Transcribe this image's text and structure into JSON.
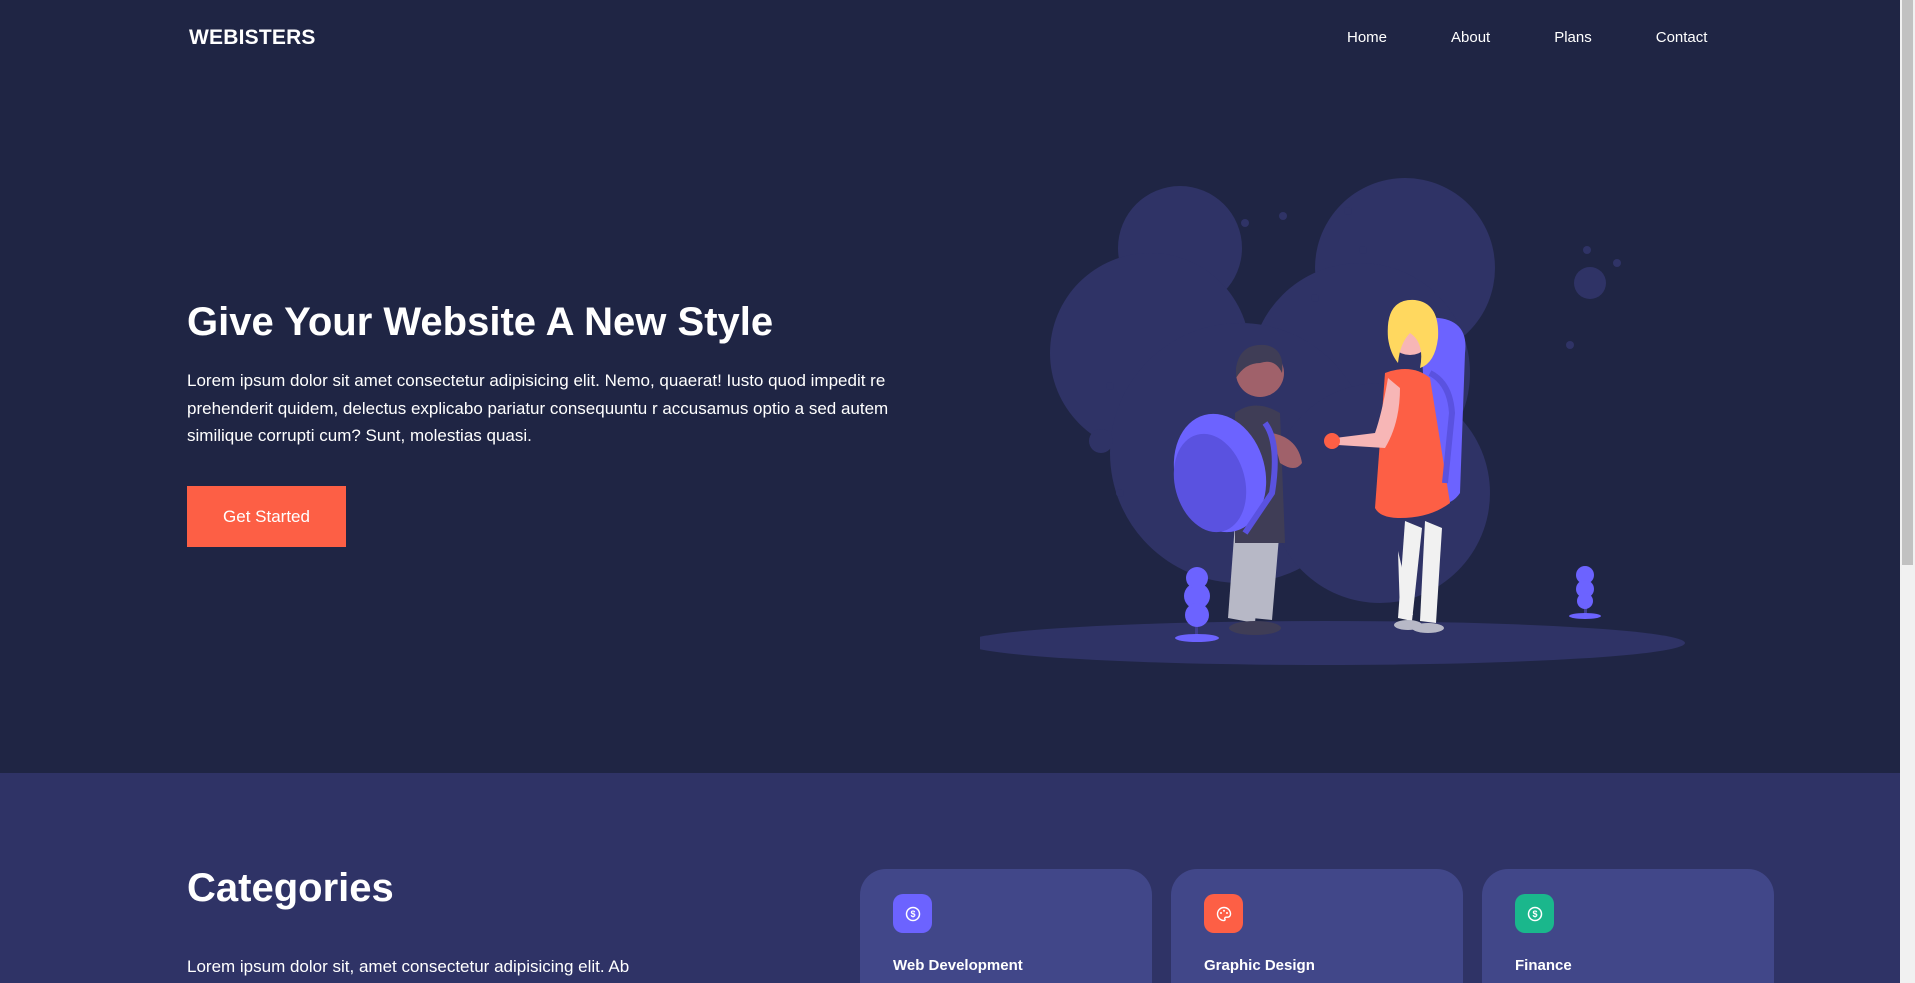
{
  "nav": {
    "brand": "WEBISTERS",
    "links": [
      "Home",
      "About",
      "Plans",
      "Contact"
    ]
  },
  "hero": {
    "title": "Give Your Website A New Style",
    "text": "Lorem ipsum dolor sit amet consectetur adipisicing elit. Nemo, quaerat! Iusto quod impedit re prehenderit quidem, delectus explicabo pariatur consequuntu r accusamus optio a sed autem similique corrupti cum? Sunt, molestias quasi.",
    "cta_label": "Get Started"
  },
  "categories": {
    "title": "Categories",
    "text": "Lorem ipsum dolor sit, amet consectetur adipisicing elit. Ab",
    "cards": [
      {
        "title": "Web Development",
        "icon": "dollar-icon",
        "color": "#6c63ff"
      },
      {
        "title": "Graphic Design",
        "icon": "palette-icon",
        "color": "#fd5f45"
      },
      {
        "title": "Finance",
        "icon": "dollar-icon",
        "color": "#1ab78c"
      }
    ]
  },
  "colors": {
    "hero_bg": "#1f2544",
    "section_bg": "#2f3366",
    "card_bg": "#414789",
    "accent": "#fd5f45",
    "purple": "#6c63ff"
  }
}
